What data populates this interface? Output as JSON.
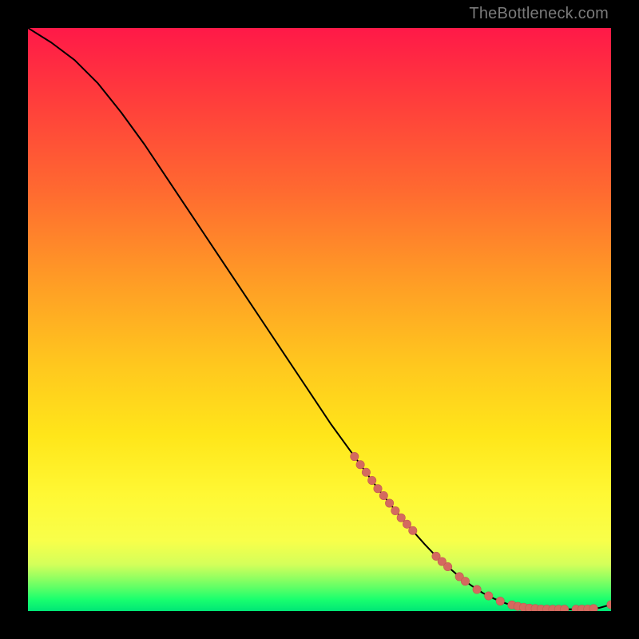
{
  "watermark": "TheBottleneck.com",
  "colors": {
    "line": "#000000",
    "marker_fill": "#d46a5f",
    "marker_stroke": "#c45a50",
    "background_black": "#000000",
    "gradient_top": "#ff1948",
    "gradient_bottom": "#00e676"
  },
  "chart_data": {
    "type": "line",
    "title": "",
    "xlabel": "",
    "ylabel": "",
    "xlim": [
      0,
      100
    ],
    "ylim": [
      0,
      100
    ],
    "series": [
      {
        "name": "bottleneck-curve",
        "x": [
          0,
          4,
          8,
          12,
          16,
          20,
          24,
          28,
          32,
          36,
          40,
          44,
          48,
          52,
          56,
          60,
          64,
          68,
          70,
          72,
          74,
          76,
          78,
          80,
          82,
          84,
          86,
          88,
          90,
          92,
          94,
          96,
          98,
          100
        ],
        "y": [
          100,
          97.5,
          94.5,
          90.5,
          85.5,
          80,
          74,
          68,
          62,
          56,
          50,
          44,
          38,
          32,
          26.5,
          21,
          16,
          11.5,
          9.4,
          7.6,
          5.9,
          4.4,
          3.1,
          2.1,
          1.3,
          0.8,
          0.5,
          0.35,
          0.3,
          0.3,
          0.3,
          0.35,
          0.55,
          1.1
        ]
      },
      {
        "name": "sample-markers",
        "x": [
          56,
          57,
          58,
          59,
          60,
          61,
          62,
          63,
          64,
          65,
          66,
          70,
          71,
          72,
          74,
          75,
          77,
          79,
          81,
          83,
          84,
          85,
          86,
          87,
          88,
          89,
          90,
          91,
          92,
          94,
          95,
          96,
          97,
          100
        ],
        "y": [
          26.5,
          25.1,
          23.8,
          22.4,
          21,
          19.8,
          18.5,
          17.2,
          16,
          14.9,
          13.8,
          9.4,
          8.5,
          7.6,
          5.9,
          5.1,
          3.7,
          2.6,
          1.7,
          1.05,
          0.8,
          0.64,
          0.5,
          0.42,
          0.35,
          0.32,
          0.3,
          0.3,
          0.3,
          0.3,
          0.32,
          0.35,
          0.43,
          1.1
        ]
      }
    ]
  }
}
